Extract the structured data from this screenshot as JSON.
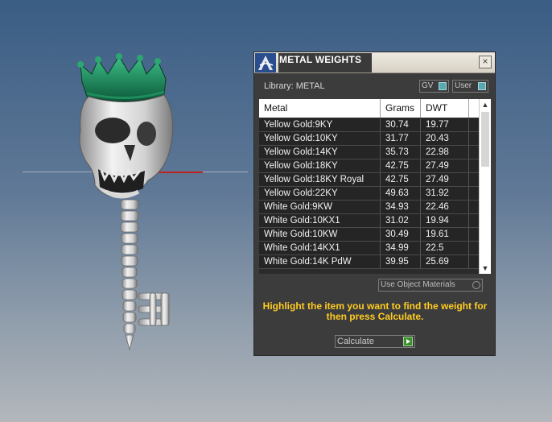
{
  "panel": {
    "title": "METAL WEIGHTS",
    "close_symbol": "×",
    "library_label": "Library: METAL",
    "toggles": {
      "gv": "GV",
      "user": "User"
    },
    "columns": [
      "Metal",
      "Grams",
      "DWT"
    ],
    "rows": [
      {
        "metal": "Yellow Gold:9KY",
        "grams": "30.74",
        "dwt": "19.77"
      },
      {
        "metal": "Yellow Gold:10KY",
        "grams": "31.77",
        "dwt": "20.43"
      },
      {
        "metal": "Yellow Gold:14KY",
        "grams": "35.73",
        "dwt": "22.98"
      },
      {
        "metal": "Yellow Gold:18KY",
        "grams": "42.75",
        "dwt": "27.49"
      },
      {
        "metal": "Yellow Gold:18KY Royal",
        "grams": "42.75",
        "dwt": "27.49"
      },
      {
        "metal": "Yellow Gold:22KY",
        "grams": "49.63",
        "dwt": "31.92"
      },
      {
        "metal": "White Gold:9KW",
        "grams": "34.93",
        "dwt": "22.46"
      },
      {
        "metal": "White Gold:10KX1",
        "grams": "31.02",
        "dwt": "19.94"
      },
      {
        "metal": "White Gold:10KW",
        "grams": "30.49",
        "dwt": "19.61"
      },
      {
        "metal": "White Gold:14KX1",
        "grams": "34.99",
        "dwt": "22.5"
      },
      {
        "metal": "White Gold:14K PdW",
        "grams": "39.95",
        "dwt": "25.69"
      }
    ],
    "use_object_materials": "Use Object Materials",
    "hint": "Highlight the item you want to find the weight for then press Calculate.",
    "calculate_label": "Calculate",
    "icons": {
      "logo": "app-logo-icon",
      "close": "close-icon",
      "scroll_up": "chevron-up-icon",
      "scroll_down": "chevron-down-icon",
      "calculate": "go-arrow-icon"
    },
    "colors": {
      "hint": "#ffcc22",
      "toggle_on": "#5aa8b0",
      "calc_go": "#3c8f2a"
    }
  }
}
